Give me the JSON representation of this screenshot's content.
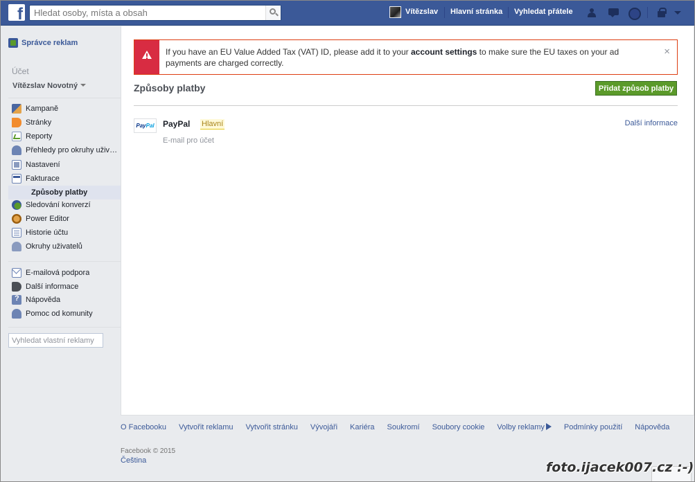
{
  "topbar": {
    "logo_letter": "f",
    "search_placeholder": "Hledat osoby, místa a obsah",
    "user_name": "Vítězslav",
    "home_label": "Hlavní stránka",
    "find_friends_label": "Vyhledat přátele"
  },
  "sidebar": {
    "header_label": "Správce reklam",
    "section_title": "Účet",
    "account_name": "Vítězslav Novotný",
    "items": [
      {
        "label": "Kampaně",
        "icon": "megaphone-icon"
      },
      {
        "label": "Stránky",
        "icon": "flag-icon"
      },
      {
        "label": "Reporty",
        "icon": "chart-icon"
      },
      {
        "label": "Přehledy pro okruhy uživatelů",
        "icon": "people-icon"
      },
      {
        "label": "Nastavení",
        "icon": "settings-icon"
      },
      {
        "label": "Fakturace",
        "icon": "billing-icon"
      }
    ],
    "selected_sub": "Způsoby platby",
    "items2": [
      {
        "label": "Sledování konverzí",
        "icon": "conversion-icon"
      },
      {
        "label": "Power Editor",
        "icon": "power-editor-icon"
      },
      {
        "label": "Historie účtu",
        "icon": "history-icon"
      },
      {
        "label": "Okruhy uživatelů",
        "icon": "audience-icon"
      }
    ],
    "support": [
      {
        "label": "E-mailová podpora",
        "icon": "mail-icon"
      },
      {
        "label": "Další informace",
        "icon": "info-icon"
      },
      {
        "label": "Nápověda",
        "icon": "help-icon"
      },
      {
        "label": "Pomoc od komunity",
        "icon": "community-icon"
      }
    ],
    "search_placeholder": "Vyhledat vlastní reklamy"
  },
  "alert": {
    "text_before": "If you have an EU Value Added Tax (VAT) ID, please add it to your ",
    "link_text": "account settings",
    "text_after": " to make sure the EU taxes on your ad payments are charged correctly.",
    "close": "×"
  },
  "main": {
    "title": "Způsoby platby",
    "add_button": "Přidat způsob platby",
    "payment": {
      "logo_part1": "Pay",
      "logo_part2": "Pal",
      "name": "PayPal",
      "badge": "Hlavní",
      "subtitle": "E-mail pro účet",
      "more_link": "Další informace"
    }
  },
  "footer": {
    "links": [
      "O Facebooku",
      "Vytvořit reklamu",
      "Vytvořit stránku",
      "Vývojáři",
      "Kariéra",
      "Soukromí",
      "Soubory cookie",
      "Volby reklamy",
      "Podmínky použití",
      "Nápověda"
    ],
    "copyright": "Facebook © 2015",
    "language": "Čeština"
  },
  "watermark": "foto.ijacek007.cz :-)",
  "colors": {
    "brand": "#3b5998",
    "alert": "#d82c42",
    "button_green": "#5b9a2a"
  }
}
